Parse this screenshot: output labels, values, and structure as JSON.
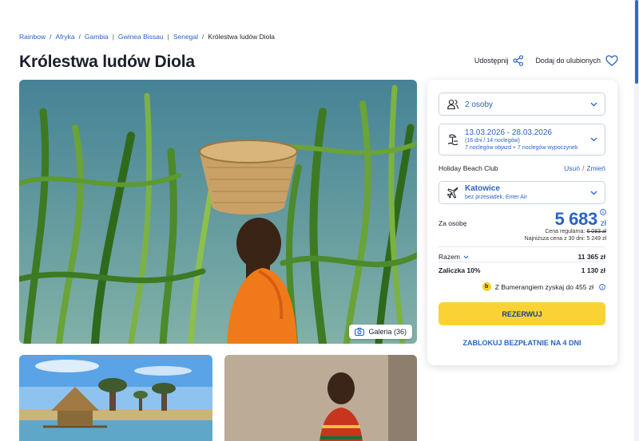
{
  "breadcrumb": {
    "items": [
      "Rainbow",
      "Afryka",
      "Gambia",
      "Gwinea Bissau",
      "Senegal"
    ],
    "separators": [
      "/",
      "/",
      "|",
      "|",
      "/"
    ],
    "current": "Królestwa ludów Diola"
  },
  "page_title": "Królestwa ludów Diola",
  "header_actions": {
    "share_label": "Udostępnij",
    "favorite_label": "Dodaj do ulubionych"
  },
  "gallery": {
    "button_label": "Galeria (36)"
  },
  "booking": {
    "persons": "2 osoby",
    "dates": "13.03.2026 - 28.03.2026",
    "duration": "(16 dni / 14 noclegów)",
    "nights_split": "7 noclegów objazd + 7 noclegów wypoczynek",
    "hotel": "Holiday Beach Club",
    "remove_label": "Usuń",
    "change_label": "Zmień",
    "flight_city": "Katowice",
    "flight_info": "bez przesiadek, Enter Air",
    "per_person_label": "Za osobę",
    "price": "5 683",
    "currency": "zł",
    "regular_label": "Cena regularna:",
    "regular_price": "6 083 zł",
    "lowest_price_text": "Najniższa cena z 30 dni: 5 249 zł",
    "total_label": "Razem",
    "total_value": "11 365 zł",
    "deposit_label": "Zaliczka 10%",
    "deposit_value": "1 130 zł",
    "bumerang_badge": "b",
    "bumerang_text": "Z Bumerangiem zyskaj do 455 zł",
    "book_button": "REZERWUJ",
    "lock_button": "ZABLOKUJ BEZPŁATNIE NA 4 DNI"
  },
  "colors": {
    "accent_blue": "#2a63c6",
    "book_yellow": "#fbd233",
    "favorite_blue": "#2a63c6"
  }
}
